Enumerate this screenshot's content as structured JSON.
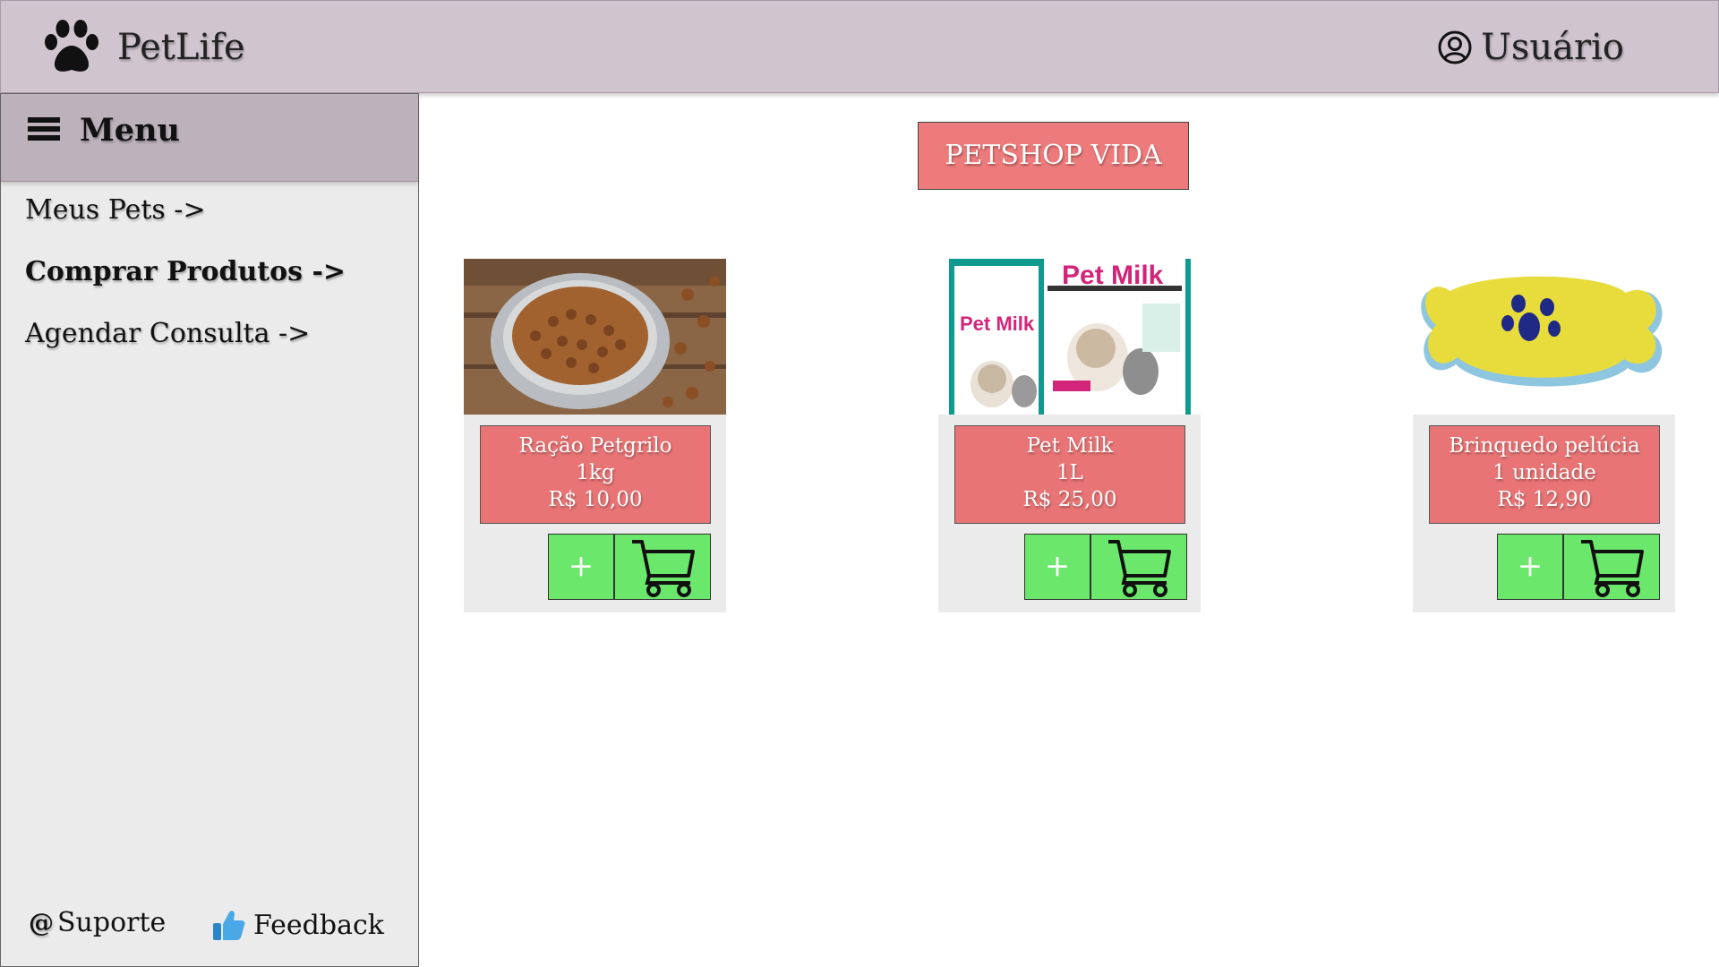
{
  "header": {
    "app_name": "PetLife",
    "user_label": "Usuário",
    "icons": {
      "logo": "paw-icon",
      "user": "user-circle-icon"
    },
    "background_color": "#d0c4cf"
  },
  "sidebar": {
    "title": "Menu",
    "items": [
      {
        "label": "Meus Pets ->",
        "active": false
      },
      {
        "label": "Comprar Produtos ->",
        "active": true
      },
      {
        "label": "Agendar Consulta ->",
        "active": false
      }
    ],
    "footer": {
      "support_icon": "@",
      "support_label": "Suporte",
      "feedback_label": "Feedback"
    }
  },
  "main": {
    "shop_name": "PETSHOP VIDA",
    "products": [
      {
        "name": "Ração Petgrilo",
        "unit": "1kg",
        "price": "R$ 10,00",
        "image": "dog-food-bowl",
        "add_label": "+"
      },
      {
        "name": "Pet Milk",
        "unit": "1L",
        "price": "R$ 25,00",
        "image": "pet-milk-package",
        "add_label": "+"
      },
      {
        "name": "Brinquedo pelúcia",
        "unit": "1 unidade",
        "price": "R$ 12,90",
        "image": "plush-bone-toy",
        "add_label": "+"
      }
    ]
  },
  "colors": {
    "accent_red": "#e87475",
    "button_green": "#6be86b",
    "sidebar_bg": "#ebebeb"
  }
}
